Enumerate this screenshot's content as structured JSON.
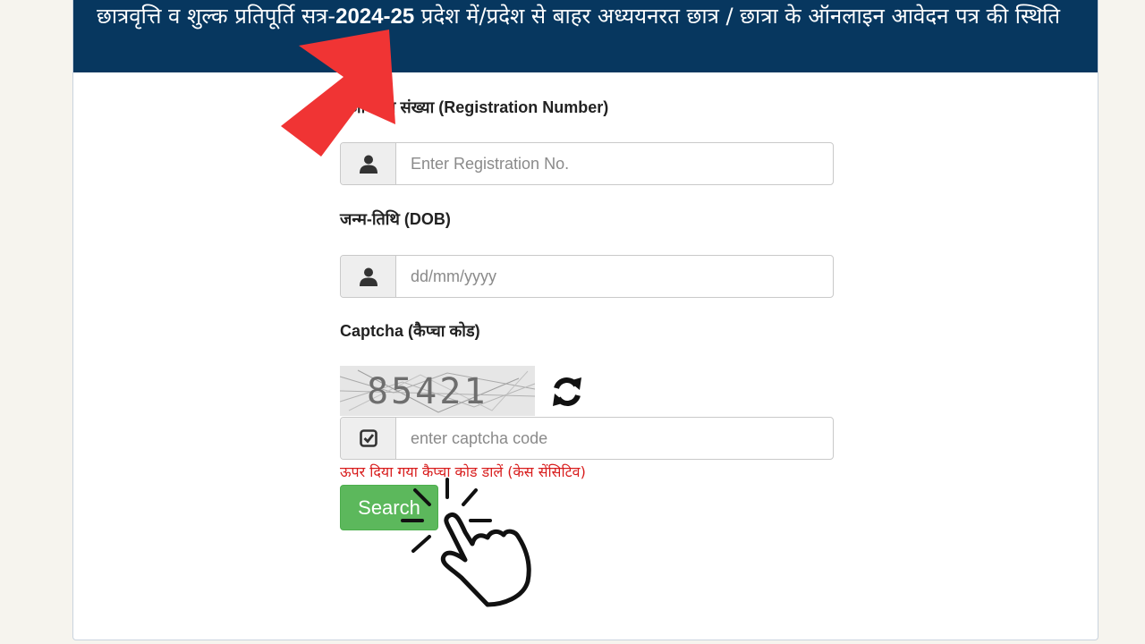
{
  "header": {
    "title_part1": "छात्रवृत्ति व शुल्क प्रतिपूर्ति सत्र-",
    "title_session": "2024-25",
    "title_part2": " प्रदेश में/प्रदेश से बाहर अध्ययनरत छात्र / छात्रा के ऑनलाइन आवेदन पत्र की स्थिति"
  },
  "form": {
    "registration": {
      "label": "पंजीकरण संख्या (Registration Number)",
      "placeholder": "Enter Registration No.",
      "icon": "user-icon"
    },
    "dob": {
      "label": "जन्म-तिथि (DOB)",
      "placeholder": "dd/mm/yyyy",
      "icon": "user-icon"
    },
    "captcha": {
      "label": "Captcha (कैप्चा कोड)",
      "image_text": "85421",
      "refresh_icon": "refresh-icon",
      "placeholder": "enter captcha code",
      "icon": "check-square-icon",
      "hint": "ऊपर दिया गया कैप्चा कोड डालें (केस सेंसिटिव)"
    },
    "search_label": "Search"
  },
  "colors": {
    "header_bg": "#07375f",
    "search_button": "#5cb85c",
    "hint_text": "#d81c1c",
    "arrow": "#f03434"
  }
}
